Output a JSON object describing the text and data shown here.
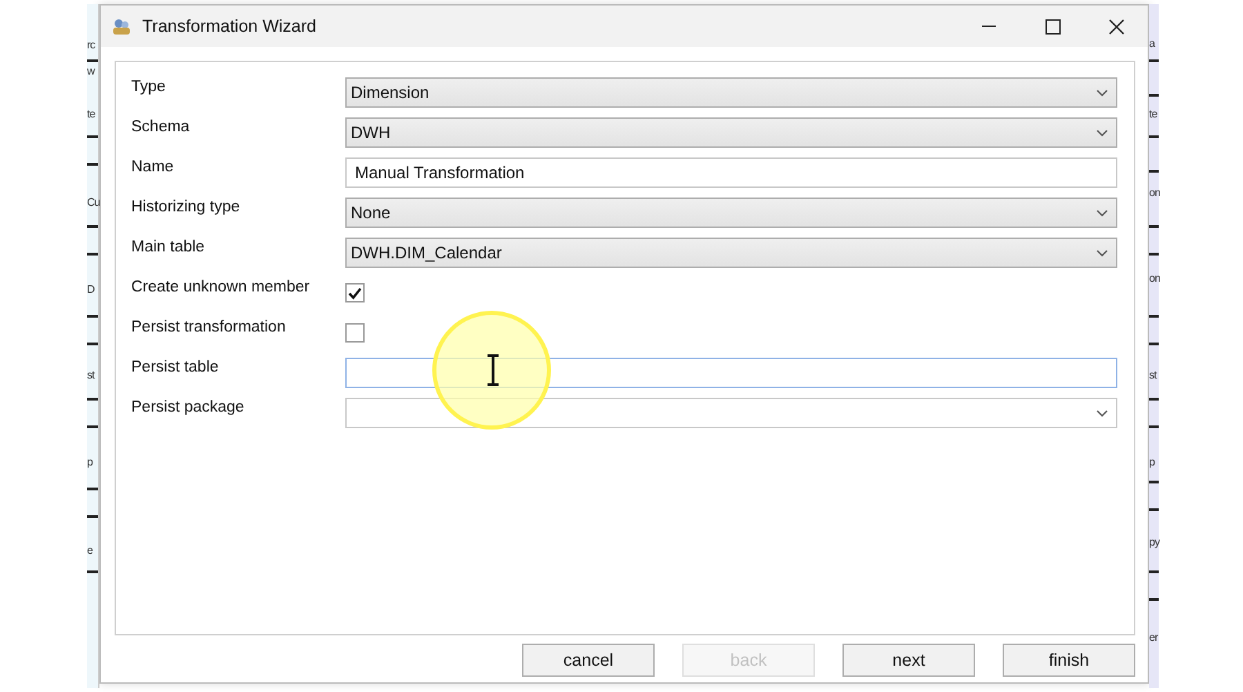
{
  "background_window": {
    "left_fragments": [
      "rc",
      "w",
      "te",
      "Cu",
      "D",
      "st",
      "p",
      "e"
    ],
    "right_fragments": [
      "a",
      "te",
      "on",
      "on",
      "st",
      "p",
      "py",
      "er"
    ]
  },
  "window": {
    "title": "Transformation Wizard"
  },
  "fields": [
    {
      "kind": "dropdown",
      "label": "Type",
      "value": "Dimension"
    },
    {
      "kind": "dropdown",
      "label": "Schema",
      "value": "DWH"
    },
    {
      "kind": "textbox",
      "label": "Name",
      "value": "Manual Transformation",
      "focused": false
    },
    {
      "kind": "dropdown",
      "label": "Historizing type",
      "value": "None"
    },
    {
      "kind": "dropdown",
      "label": "Main table",
      "value": "DWH.DIM_Calendar"
    },
    {
      "kind": "checkbox",
      "label": "Create unknown member",
      "checked": true
    },
    {
      "kind": "checkbox",
      "label": "Persist transformation",
      "checked": false
    },
    {
      "kind": "textbox",
      "label": "Persist table",
      "focused": true
    },
    {
      "kind": "combobox",
      "label": "Persist package"
    }
  ],
  "buttons": [
    {
      "label": "cancel",
      "disabled": false
    },
    {
      "label": "back",
      "disabled": true
    },
    {
      "label": "next",
      "disabled": false
    },
    {
      "label": "finish",
      "disabled": false
    }
  ]
}
